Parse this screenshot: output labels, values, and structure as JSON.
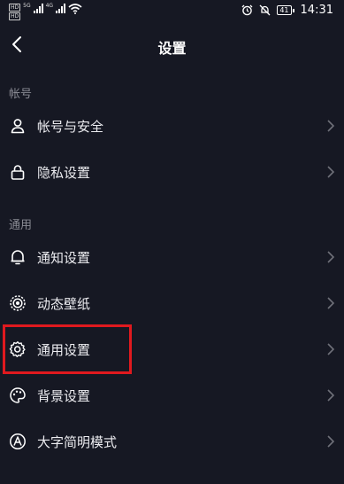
{
  "status_bar": {
    "hd1": "HD",
    "hd2": "HD",
    "net1": "5G",
    "net2": "4G",
    "battery": "41",
    "time": "14:31"
  },
  "header": {
    "title": "设置",
    "back_icon": "chevron-left-icon"
  },
  "sections": {
    "account": {
      "label": "帐号",
      "items": [
        {
          "label": "帐号与安全",
          "icon": "person-icon"
        },
        {
          "label": "隐私设置",
          "icon": "lock-icon"
        }
      ]
    },
    "general": {
      "label": "通用",
      "items": [
        {
          "label": "通知设置",
          "icon": "bell-icon"
        },
        {
          "label": "动态壁纸",
          "icon": "wallpaper-icon"
        },
        {
          "label": "通用设置",
          "icon": "gear-icon"
        },
        {
          "label": "背景设置",
          "icon": "palette-icon"
        },
        {
          "label": "大字简明模式",
          "icon": "font-size-icon"
        }
      ]
    }
  },
  "colors": {
    "background": "#161823",
    "highlight": "#e0191e",
    "text": "#ececf0",
    "muted": "#8a8b94"
  }
}
